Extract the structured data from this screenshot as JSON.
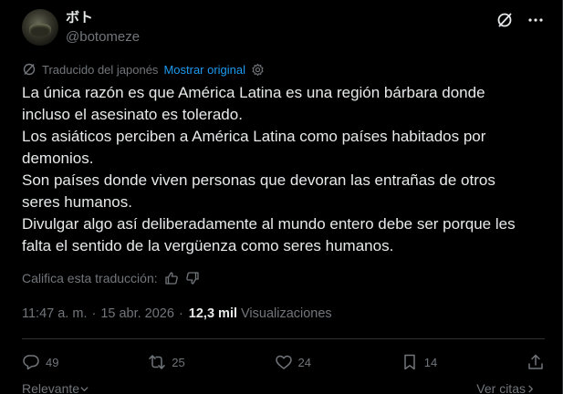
{
  "tweet": {
    "display_name": "ボト",
    "handle": "@botomeze",
    "translated_label": "Traducido del japonés",
    "show_original": "Mostrar original",
    "body_lines": [
      "La única razón es que América Latina es una región bárbara donde incluso el asesinato es tolerado.",
      "Los asiáticos perciben a América Latina como países habitados por demonios.",
      "Son países donde viven personas que devoran las entrañas de otros seres humanos.",
      "Divulgar algo así deliberadamente al mundo entero debe ser porque les falta el sentido de la vergüenza como seres humanos."
    ],
    "rate_label": "Califica esta traducción:",
    "time": "11:47 a. m.",
    "separator": "·",
    "date": "15 abr. 2026",
    "views_count": "12,3 mil",
    "views_label": "Visualizaciones"
  },
  "actions": {
    "replies": "49",
    "reposts": "25",
    "likes": "24",
    "bookmarks": "14"
  },
  "footer": {
    "relevant_label": "Relevante",
    "quotes_label": "Ver citas"
  },
  "icons": [
    "grok-icon",
    "more-icon",
    "translate-icon",
    "settings-icon",
    "thumbs-up-icon",
    "thumbs-down-icon",
    "reply-icon",
    "repost-icon",
    "like-icon",
    "bookmark-icon",
    "share-icon",
    "chevron-down-icon",
    "chevron-right-icon"
  ],
  "colors": {
    "background": "#000000",
    "text": "#e7e9ea",
    "muted": "#71767b",
    "accent": "#1d9bf0"
  }
}
